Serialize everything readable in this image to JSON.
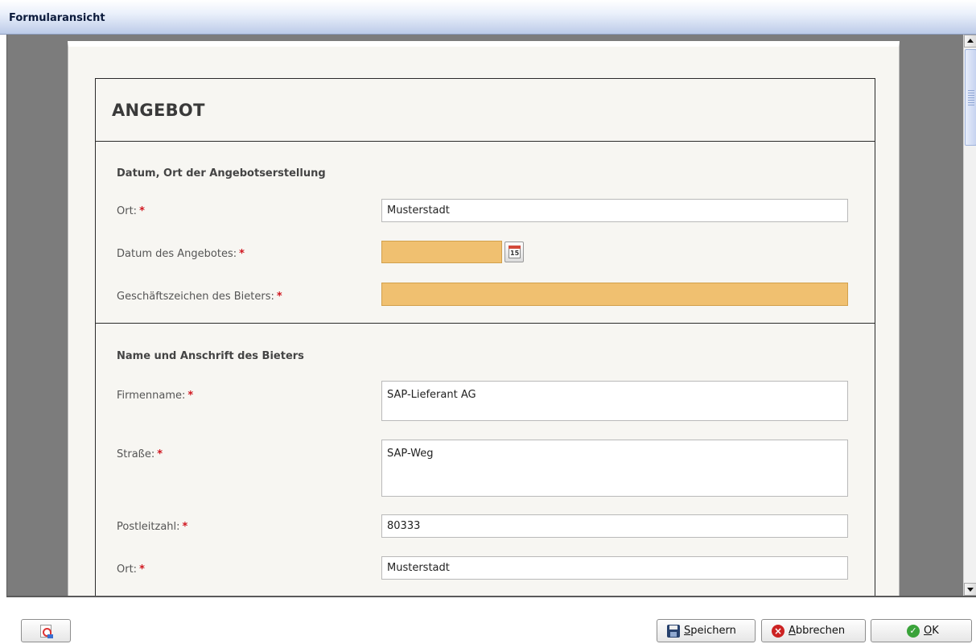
{
  "window": {
    "title": "Formularansicht"
  },
  "form": {
    "heading": "ANGEBOT",
    "section1": {
      "title": "Datum, Ort der Angebotserstellung",
      "ort_label": "Ort:",
      "ort_value": "Musterstadt",
      "datum_label": "Datum des Angebotes:",
      "datum_value": "",
      "calendar_day": "15",
      "zeichen_label": "Geschäftszeichen des Bieters:",
      "zeichen_value": ""
    },
    "section2": {
      "title": "Name und Anschrift des Bieters",
      "firma_label": "Firmenname:",
      "firma_value": "SAP-Lieferant AG",
      "strasse_label": "Straße:",
      "strasse_value": "SAP-Weg",
      "plz_label": "Postleitzahl:",
      "plz_value": "80333",
      "ort_label": "Ort:",
      "ort_value": "Musterstadt"
    },
    "required_marker": "*"
  },
  "buttons": {
    "save": "Speichern",
    "cancel": "Abbrechen",
    "ok": "OK"
  },
  "icons": {
    "pdf": "pdf-icon",
    "calendar": "calendar-icon",
    "save": "floppy-disk-icon",
    "cancel": "cancel-x-icon",
    "ok": "check-circle-icon"
  },
  "colors": {
    "required_field": "#f0c070",
    "required_marker": "#d0161f"
  }
}
